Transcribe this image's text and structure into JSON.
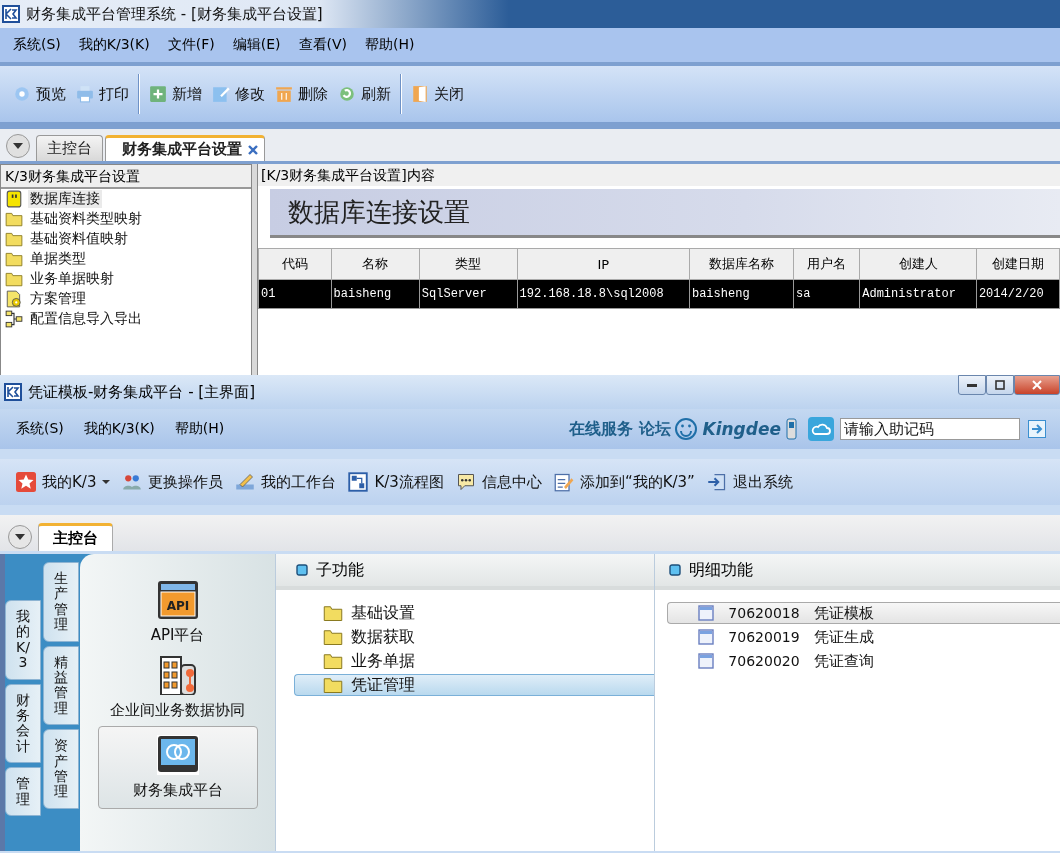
{
  "config_window": {
    "title": "财务集成平台管理系统 - [财务集成平台设置]",
    "menu": [
      "系统(S)",
      "我的K/3(K)",
      "文件(F)",
      "编辑(E)",
      "查看(V)",
      "帮助(H)"
    ],
    "toolbar": [
      {
        "label": "预览",
        "kind": "preview"
      },
      {
        "label": "打印",
        "kind": "print"
      },
      {
        "label": "新增",
        "kind": "add",
        "group_start": true
      },
      {
        "label": "修改",
        "kind": "edit"
      },
      {
        "label": "删除",
        "kind": "delete"
      },
      {
        "label": "刷新",
        "kind": "refresh"
      },
      {
        "label": "关闭",
        "kind": "close",
        "group_start": true
      }
    ],
    "tabs": [
      {
        "label": "主控台",
        "selected": false,
        "closable": false
      },
      {
        "label": "财务集成平台设置",
        "selected": true,
        "closable": true
      }
    ],
    "tree": {
      "title": "K/3财务集成平台设置",
      "items": [
        {
          "label": "数据库连接",
          "kind": "database",
          "selected": true
        },
        {
          "label": "基础资料类型映射",
          "kind": "folder",
          "selected": false
        },
        {
          "label": "基础资料值映射",
          "kind": "folder",
          "selected": false
        },
        {
          "label": "单据类型",
          "kind": "folder",
          "selected": false
        },
        {
          "label": "业务单据映射",
          "kind": "folder",
          "selected": false
        },
        {
          "label": "方案管理",
          "kind": "scheme",
          "selected": false
        },
        {
          "label": "配置信息导入导出",
          "kind": "config",
          "selected": false
        }
      ]
    },
    "content": {
      "title": "[K/3财务集成平台设置]内容",
      "banner": "数据库连接设置",
      "table": {
        "columns": [
          "代码",
          "名称",
          "类型",
          "IP",
          "数据库名称",
          "用户名",
          "创建人",
          "创建日期"
        ],
        "rows": [
          {
            "cells": [
              "01",
              "baisheng",
              "SqlServer",
              "192.168.18.8\\sql2008",
              "baisheng",
              "sa",
              "Administrator",
              "2014/2/20"
            ],
            "selected": true
          }
        ]
      }
    }
  },
  "main_window": {
    "title": "凭证模板-财务集成平台 - [主界面]",
    "menu": [
      "系统(S)",
      "我的K/3(K)",
      "帮助(H)"
    ],
    "service_links": [
      "在线服务",
      "论坛"
    ],
    "brand": "Kingdee",
    "search": {
      "placeholder": "请输入助记码"
    },
    "toolbar": [
      {
        "label": "我的K/3",
        "kind": "star",
        "dropdown": true
      },
      {
        "label": "更换操作员",
        "kind": "users",
        "dropdown": false
      },
      {
        "label": "我的工作台",
        "kind": "workbench",
        "dropdown": false
      },
      {
        "label": "K/3流程图",
        "kind": "flowchart",
        "dropdown": false
      },
      {
        "label": "信息中心",
        "kind": "message",
        "dropdown": false
      },
      {
        "label": "添加到“我的K/3”",
        "kind": "notepad",
        "dropdown": false
      },
      {
        "label": "退出系统",
        "kind": "exit",
        "dropdown": false
      }
    ],
    "tabs": [
      {
        "label": "主控台",
        "selected": true
      }
    ],
    "side_tab_columns": [
      {
        "tabs": [
          "我的K/3",
          "财务会计",
          "管理"
        ]
      },
      {
        "tabs": [
          "生产管理",
          "精益管理",
          "资产管理"
        ]
      }
    ],
    "modules": [
      {
        "label": "API平台",
        "kind": "api",
        "icon_text": "API",
        "selected": false
      },
      {
        "label": "企业间业务数据协同",
        "kind": "collab",
        "selected": false
      },
      {
        "label": "财务集成平台",
        "kind": "finance",
        "selected": true
      }
    ],
    "sub_functions": {
      "title": "子功能",
      "items": [
        {
          "label": "基础设置",
          "selected": false
        },
        {
          "label": "数据获取",
          "selected": false
        },
        {
          "label": "业务单据",
          "selected": false
        },
        {
          "label": "凭证管理",
          "selected": true
        }
      ]
    },
    "details": {
      "title": "明细功能",
      "items": [
        {
          "code": "70620018",
          "label": "凭证模板",
          "selected": true
        },
        {
          "code": "70620019",
          "label": "凭证生成",
          "selected": false
        },
        {
          "code": "70620020",
          "label": "凭证查询",
          "selected": false
        }
      ]
    }
  }
}
